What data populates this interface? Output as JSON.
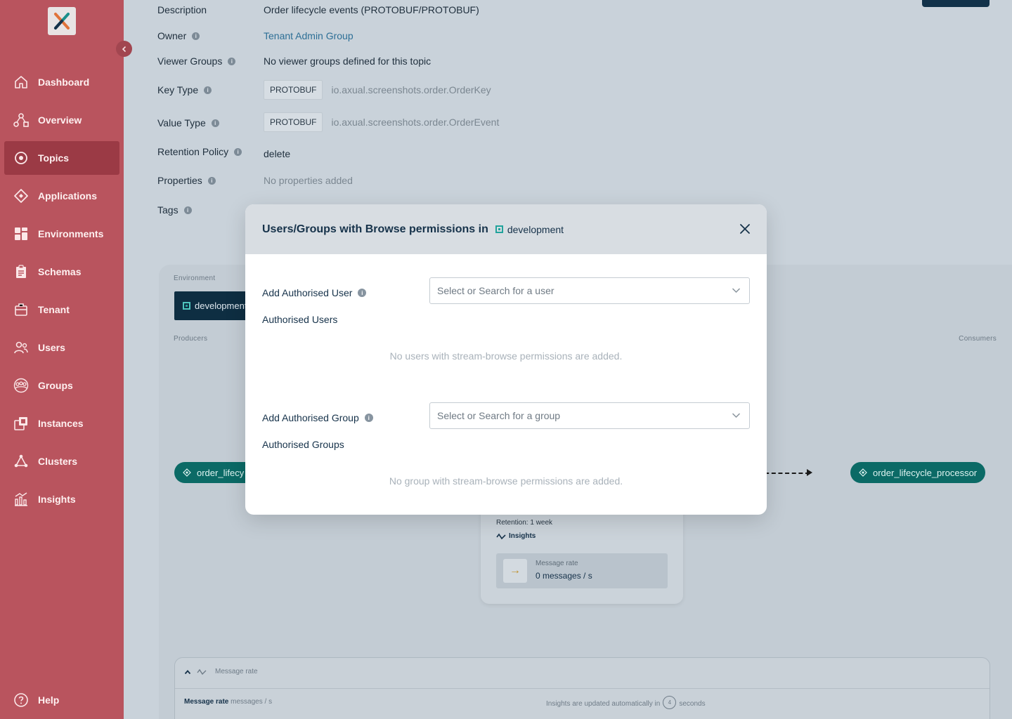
{
  "sidebar": {
    "items": [
      {
        "label": "Dashboard",
        "icon": "home-icon"
      },
      {
        "label": "Overview",
        "icon": "overview-icon"
      },
      {
        "label": "Topics",
        "icon": "topics-icon"
      },
      {
        "label": "Applications",
        "icon": "applications-icon"
      },
      {
        "label": "Environments",
        "icon": "environments-icon"
      },
      {
        "label": "Schemas",
        "icon": "schemas-icon"
      },
      {
        "label": "Tenant",
        "icon": "tenant-icon"
      },
      {
        "label": "Users",
        "icon": "users-icon"
      },
      {
        "label": "Groups",
        "icon": "groups-icon"
      },
      {
        "label": "Instances",
        "icon": "instances-icon"
      },
      {
        "label": "Clusters",
        "icon": "clusters-icon"
      },
      {
        "label": "Insights",
        "icon": "insights-icon"
      }
    ],
    "help": "Help",
    "active": "Topics"
  },
  "details": {
    "description_label": "Description",
    "description_value": "Order lifecycle events (PROTOBUF/PROTOBUF)",
    "owner_label": "Owner",
    "owner_value": "Tenant Admin Group",
    "viewer_groups_label": "Viewer Groups",
    "viewer_groups_value": "No viewer groups defined for this topic",
    "key_type_label": "Key Type",
    "key_type_chip": "PROTOBUF",
    "key_type_name": "io.axual.screenshots.order.OrderKey",
    "value_type_label": "Value Type",
    "value_type_chip": "PROTOBUF",
    "value_type_name": "io.axual.screenshots.order.OrderEvent",
    "retention_label": "Retention Policy",
    "retention_value": "delete",
    "properties_label": "Properties",
    "properties_value": "No properties added",
    "tags_label": "Tags"
  },
  "graph": {
    "environment_label": "Environment",
    "environment_name": "development",
    "producers_label": "Producers",
    "consumers_label": "Consumers",
    "producer_app": "order_lifecy",
    "consumer_app": "order_lifecycle_processor",
    "retention": "Retention: 1 week",
    "insights_link": "Insights",
    "message_rate_label": "Message rate",
    "message_rate_value": "0 messages / s"
  },
  "metrics": {
    "header": "Message rate",
    "title": "Message rate",
    "unit": "messages / s",
    "update_prefix": "Insights are updated automatically in",
    "countdown": "4",
    "update_suffix": "seconds"
  },
  "modal": {
    "title": "Users/Groups with Browse permissions in",
    "environment": "development",
    "add_user_label": "Add Authorised User",
    "user_placeholder": "Select or Search for a user",
    "authorised_users_label": "Authorised Users",
    "no_users_msg": "No users with stream-browse permissions are added.",
    "add_group_label": "Add Authorised Group",
    "group_placeholder": "Select or Search for a group",
    "authorised_groups_label": "Authorised Groups",
    "no_groups_msg": "No group with stream-browse permissions are added."
  }
}
